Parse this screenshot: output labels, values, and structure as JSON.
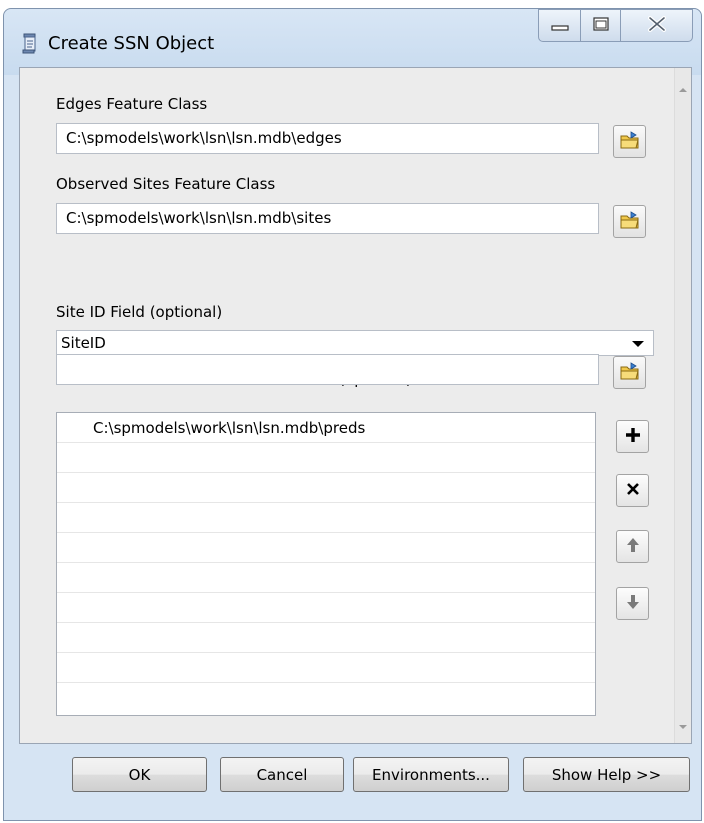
{
  "window": {
    "title": "Create SSN Object"
  },
  "fields": {
    "edges": {
      "label": "Edges Feature Class",
      "value": "C:\\spmodels\\work\\lsn\\lsn.mdb\\edges"
    },
    "sites": {
      "label": "Observed Sites Feature Class",
      "value": "C:\\spmodels\\work\\lsn\\lsn.mdb\\sites"
    },
    "site_id": {
      "label": "Site ID Field (optional)",
      "value": "SiteID"
    },
    "prediction": {
      "label": "Prediction Sites Feature Class Names (optional)",
      "value": "",
      "items": [
        "C:\\spmodels\\work\\lsn\\lsn.mdb\\preds",
        "",
        "",
        "",
        "",
        "",
        "",
        "",
        "",
        ""
      ]
    }
  },
  "buttons": {
    "ok": "OK",
    "cancel": "Cancel",
    "environments": "Environments...",
    "show_help": "Show Help >>"
  },
  "icons": {
    "app": "toolscript-icon",
    "browse": "open-folder-icon",
    "add": "plus-icon",
    "remove": "x-icon",
    "up": "arrow-up-icon",
    "down": "arrow-down-icon"
  }
}
